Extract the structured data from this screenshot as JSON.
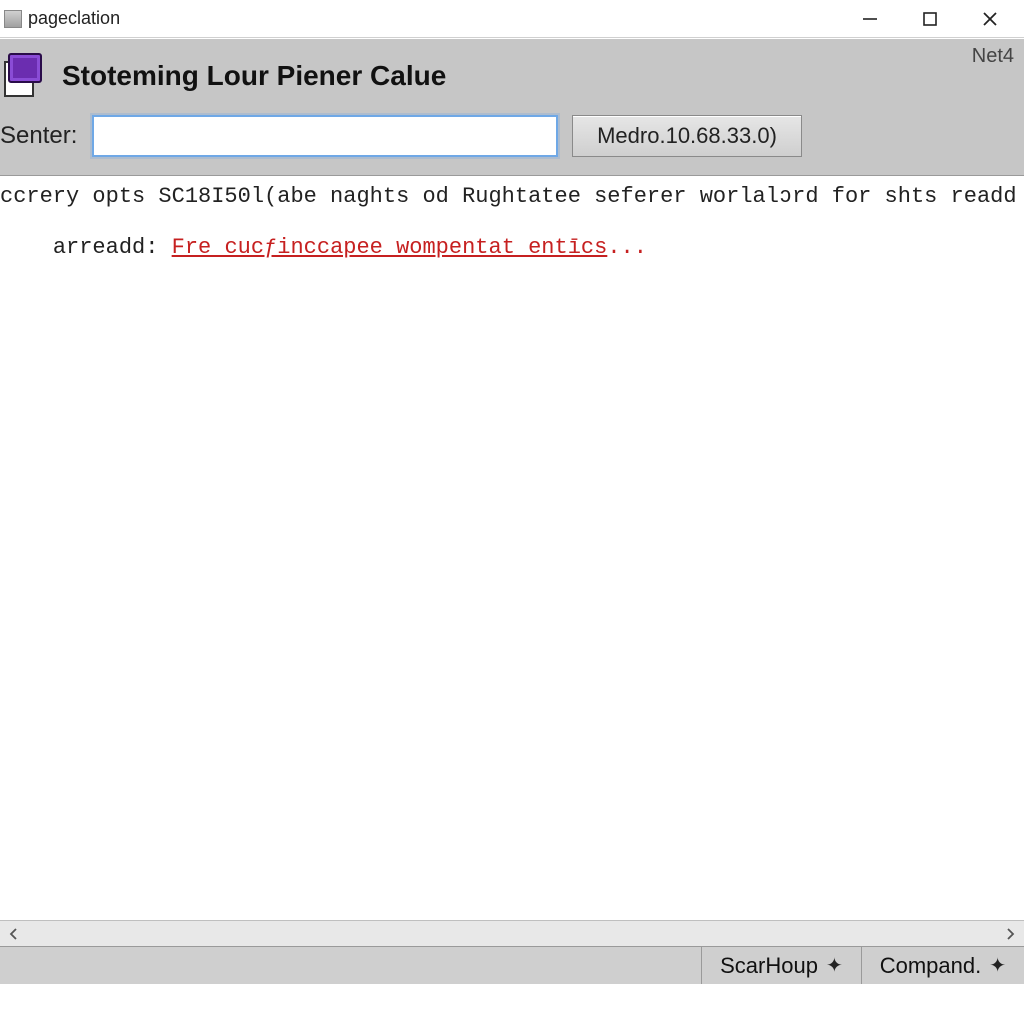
{
  "window": {
    "title": "pageclation"
  },
  "header": {
    "page_title": "Stoteming Lour Piener Calue",
    "net_label": "Net4",
    "senter_label": "Senter:",
    "senter_value": "",
    "senter_placeholder": "",
    "medro_button": "Medro.10.68.33.0)"
  },
  "content": {
    "line1": "ccrery opts SC18I50l(abe naghts od Rughtatee seferer worlalↄrd for shts readd thur",
    "line2_prefix": "arreadd: ",
    "line2_link": "Fre cucƒinccapee wompentat entīcs",
    "line2_suffix": "..."
  },
  "status": {
    "left_cell": "ScarHoup",
    "right_cell": "Compand."
  },
  "icons": {
    "minimize": "minimize",
    "maximize": "maximize",
    "close": "close",
    "scroll_left": "chevron-left",
    "scroll_right": "chevron-right",
    "status_arrow": "arrow-right"
  }
}
